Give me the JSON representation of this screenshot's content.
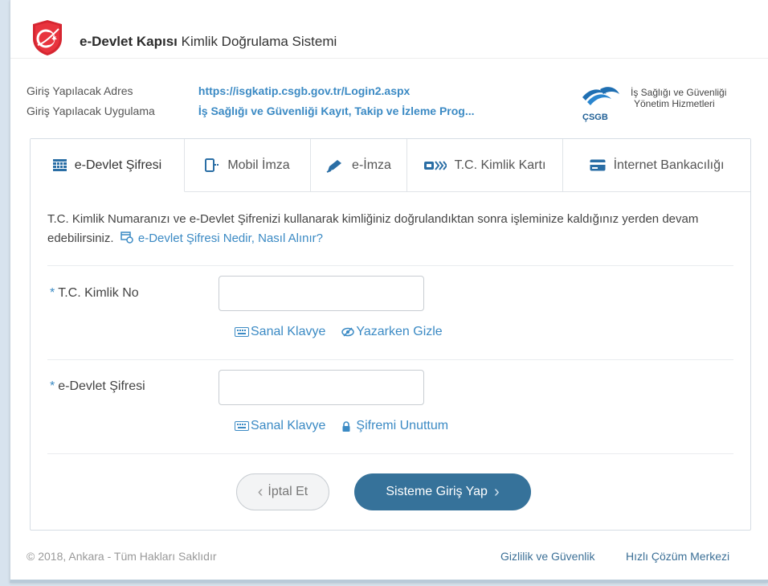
{
  "header": {
    "brand_strong": "e-Devlet Kapısı",
    "brand_rest": "Kimlik Doğrulama Sistemi"
  },
  "info": {
    "address_label": "Giriş Yapılacak Adres",
    "address_value": "https://isgkatip.csgb.gov.tr/Login2.aspx",
    "app_label": "Giriş Yapılacak Uygulama",
    "app_value": "İş Sağlığı ve Güvenliği Kayıt, Takip ve İzleme Prog..."
  },
  "ministry": {
    "abbr": "ÇSGB",
    "name_line1": "İş Sağlığı ve Güvenliği",
    "name_line2": "Yönetim Hizmetleri"
  },
  "tabs": [
    {
      "label": "e-Devlet Şifresi",
      "icon": "keypad-icon",
      "active": true
    },
    {
      "label": "Mobil İmza",
      "icon": "mobile-signature-icon",
      "active": false
    },
    {
      "label": "e-İmza",
      "icon": "pen-icon",
      "active": false
    },
    {
      "label": "T.C. Kimlik Kartı",
      "icon": "id-card-icon",
      "active": false
    },
    {
      "label": "İnternet Bankacılığı",
      "icon": "credit-card-icon",
      "active": false
    }
  ],
  "description": {
    "text": "T.C. Kimlik Numaranızı ve e-Devlet Şifrenizi kullanarak kimliğiniz doğrulandıktan sonra işleminize kaldığınız yerden devam edebilirsiniz.",
    "link": "e-Devlet Şifresi Nedir, Nasıl Alınır?"
  },
  "form": {
    "tc_label": "T.C. Kimlik No",
    "tc_value": "",
    "password_label": "e-Devlet Şifresi",
    "password_value": "",
    "required_mark": "*",
    "virtual_keyboard": "Sanal Klavye",
    "hide_while_typing": "Yazarken Gizle",
    "forgot_password": "Şifremi Unuttum"
  },
  "buttons": {
    "cancel": "İptal Et",
    "submit": "Sisteme Giriş Yap"
  },
  "footer": {
    "copyright": "© 2018, Ankara - Tüm Hakları Saklıdır",
    "privacy": "Gizlilik ve Güvenlik",
    "help": "Hızlı Çözüm Merkezi"
  },
  "colors": {
    "accent": "#3b8ac4",
    "button_primary": "#36729a",
    "logo_red": "#d62631"
  }
}
